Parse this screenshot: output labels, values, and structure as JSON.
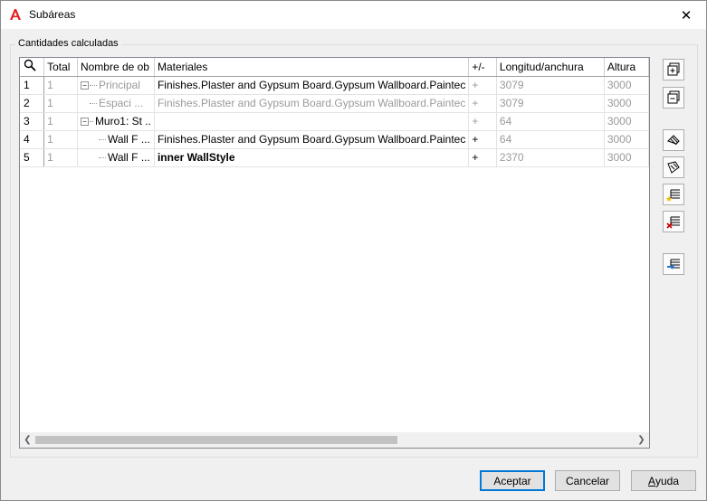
{
  "window": {
    "title": "Subáreas",
    "close": "✕"
  },
  "group": {
    "label": "Cantidades calculadas"
  },
  "table": {
    "headers": [
      "Total",
      "Nombre de ob",
      "Materiales",
      "+/-",
      "Longitud/anchura",
      "Altura"
    ],
    "rows": [
      {
        "num": "1",
        "total": "1",
        "name": "Principal",
        "material": "Finishes.Plaster and Gypsum Board.Gypsum Wallboard.Paintec",
        "sign": "+",
        "length": "3079",
        "height": "3000"
      },
      {
        "num": "2",
        "total": "1",
        "name": "Espaci ...",
        "material": "Finishes.Plaster and Gypsum Board.Gypsum Wallboard.Paintec",
        "sign": "+",
        "length": "3079",
        "height": "3000"
      },
      {
        "num": "3",
        "total": "1",
        "name": "Muro1: St ..",
        "material": "",
        "sign": "+",
        "length": "64",
        "height": "3000"
      },
      {
        "num": "4",
        "total": "1",
        "name": "Wall F ...",
        "material": "Finishes.Plaster and Gypsum Board.Gypsum Wallboard.Paintec",
        "sign": "+",
        "length": "64",
        "height": "3000"
      },
      {
        "num": "5",
        "total": "1",
        "name": "Wall F ...",
        "material": "inner WallStyle",
        "sign": "+",
        "length": "2370",
        "height": "3000"
      }
    ]
  },
  "buttons": {
    "accept": "Aceptar",
    "cancel": "Cancelar",
    "help_u": "A",
    "help_rest": "yuda"
  },
  "colors": {
    "accent": "#0078d7",
    "disabled_text": "#9a9a9a",
    "app_icon": "#e02020"
  }
}
